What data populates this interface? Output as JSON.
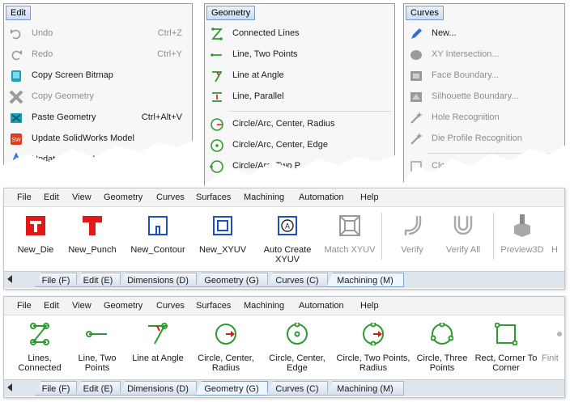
{
  "edit_menu": {
    "title": "Edit",
    "items": [
      {
        "label": "Undo",
        "shortcut": "Ctrl+Z",
        "disabled": true
      },
      {
        "label": "Redo",
        "shortcut": "Ctrl+Y",
        "disabled": true
      },
      {
        "label": "Copy Screen Bitmap",
        "shortcut": "",
        "disabled": false
      },
      {
        "label": "Copy Geometry",
        "shortcut": "",
        "disabled": true
      },
      {
        "label": "Paste Geometry",
        "shortcut": "Ctrl+Alt+V",
        "disabled": false
      },
      {
        "label": "Update SolidWorks Model",
        "shortcut": "",
        "disabled": false
      },
      {
        "label": "Update Alibre Model",
        "shortcut": "",
        "disabled": false
      }
    ]
  },
  "geometry_menu": {
    "title": "Geometry",
    "items": [
      {
        "label": "Connected Lines"
      },
      {
        "label": "Line, Two Points"
      },
      {
        "label": "Line at Angle"
      },
      {
        "label": "Line, Parallel"
      },
      {
        "label": "Circle/Arc, Center, Radius"
      },
      {
        "label": "Circle/Arc, Center, Edge"
      },
      {
        "label": "Circle/Arc, Two P"
      }
    ]
  },
  "curves_menu": {
    "title": "Curves",
    "items": [
      {
        "label": "New...",
        "disabled": false
      },
      {
        "label": "XY Intersection...",
        "disabled": true
      },
      {
        "label": "Face Boundary...",
        "disabled": true
      },
      {
        "label": "Silhouette Boundary...",
        "disabled": true
      },
      {
        "label": "Hole Recognition",
        "disabled": true
      },
      {
        "label": "Die Profile Recognition",
        "disabled": true
      },
      {
        "label": "Close",
        "disabled": true
      }
    ]
  },
  "menubar": [
    "File",
    "Edit",
    "View",
    "Geometry",
    "Curves",
    "Surfaces",
    "Machining",
    "Automation",
    "Help"
  ],
  "machining_ribbon": {
    "tools": [
      {
        "label": "New_Die",
        "disabled": false
      },
      {
        "label": "New_Punch",
        "disabled": false
      },
      {
        "label": "New_Contour",
        "disabled": false
      },
      {
        "label": "New_XYUV",
        "disabled": false
      },
      {
        "label": "Auto Create XYUV",
        "disabled": false
      },
      {
        "label": "Match XYUV",
        "disabled": true
      },
      {
        "label": "Verify",
        "disabled": true
      },
      {
        "label": "Verify All",
        "disabled": true
      },
      {
        "label": "Preview3D",
        "disabled": true
      },
      {
        "label": "H",
        "disabled": true
      }
    ],
    "tabs": [
      "File (F)",
      "Edit (E)",
      "Dimensions (D)",
      "Geometry (G)",
      "Curves (C)",
      "Machining (M)"
    ],
    "active_tab": "Machining (M)"
  },
  "geometry_ribbon": {
    "tools": [
      {
        "label": "Lines, Connected"
      },
      {
        "label": "Line, Two Points"
      },
      {
        "label": "Line at Angle"
      },
      {
        "label": "Circle, Center, Radius"
      },
      {
        "label": "Circle, Center, Edge"
      },
      {
        "label": "Circle, Two Points, Radius"
      },
      {
        "label": "Circle, Three Points"
      },
      {
        "label": "Rect, Corner To Corner"
      },
      {
        "label": "Finit"
      }
    ],
    "tabs": [
      "File (F)",
      "Edit (E)",
      "Dimensions (D)",
      "Geometry (G)",
      "Curves (C)",
      "Machining (M)"
    ],
    "active_tab": "Geometry (G)"
  },
  "colors": {
    "accent_green": "#2e9b2e",
    "accent_red": "#e01818",
    "accent_blue": "#1f4fbf",
    "disabled_gray": "#9a9a9a"
  }
}
